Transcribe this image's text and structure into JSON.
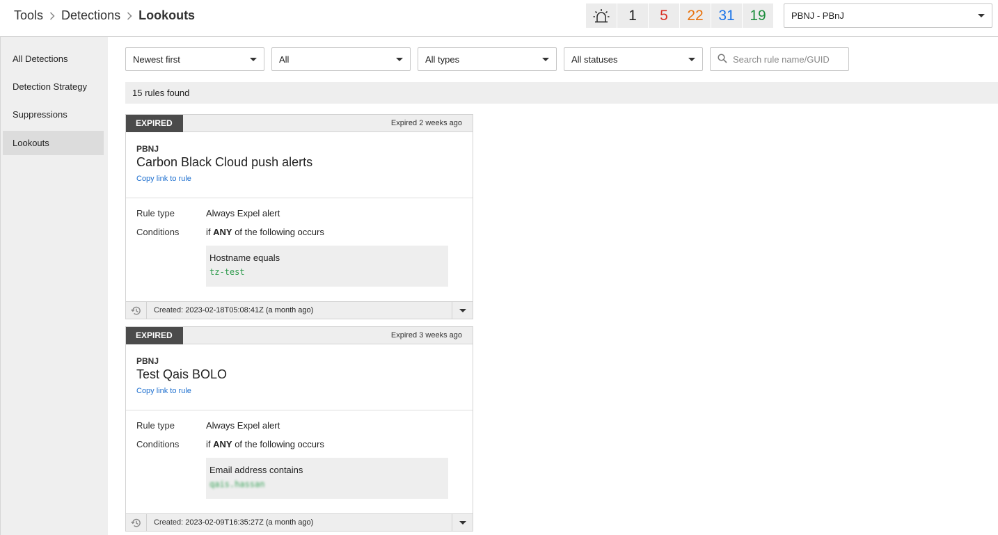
{
  "header": {
    "breadcrumb": [
      "Tools",
      "Detections",
      "Lookouts"
    ],
    "counts": [
      {
        "value": "1",
        "color": "#222222"
      },
      {
        "value": "5",
        "color": "#d93025"
      },
      {
        "value": "22",
        "color": "#e8710a"
      },
      {
        "value": "31",
        "color": "#1a73e8"
      },
      {
        "value": "19",
        "color": "#1e8e3e"
      }
    ],
    "alarm_icon": "alarm-light-icon",
    "org_select": "PBNJ - PBnJ"
  },
  "sidebar": {
    "items": [
      "All Detections",
      "Detection Strategy",
      "Suppressions",
      "Lookouts"
    ],
    "active": "Lookouts"
  },
  "filters": {
    "sort": "Newest first",
    "scope": "All",
    "types": "All types",
    "statuses": "All statuses",
    "search_placeholder": "Search rule name/GUID"
  },
  "results": "15 rules found",
  "rules": [
    {
      "status": "EXPIRED",
      "expired_ago": "Expired 2 weeks ago",
      "org": "PBNJ",
      "name": "Carbon Black Cloud push alerts",
      "copy_link": "Copy link to rule",
      "rule_type_label": "Rule type",
      "rule_type": "Always Expel alert",
      "conditions_label": "Conditions",
      "cond_prefix": "if",
      "cond_any": "ANY",
      "cond_suffix": "of the following occurs",
      "field": "Hostname equals",
      "field_value": "tz-test",
      "created_label": "Created:",
      "created": "2023-02-18T05:08:41Z (a month ago)"
    },
    {
      "status": "EXPIRED",
      "expired_ago": "Expired 3 weeks ago",
      "org": "PBNJ",
      "name": "Test Qais BOLO",
      "copy_link": "Copy link to rule",
      "rule_type_label": "Rule type",
      "rule_type": "Always Expel alert",
      "conditions_label": "Conditions",
      "cond_prefix": "if",
      "cond_any": "ANY",
      "cond_suffix": "of the following occurs",
      "field": "Email address contains",
      "field_value": "qais.hassan",
      "created_label": "Created:",
      "created": "2023-02-09T16:35:27Z (a month ago)"
    }
  ]
}
